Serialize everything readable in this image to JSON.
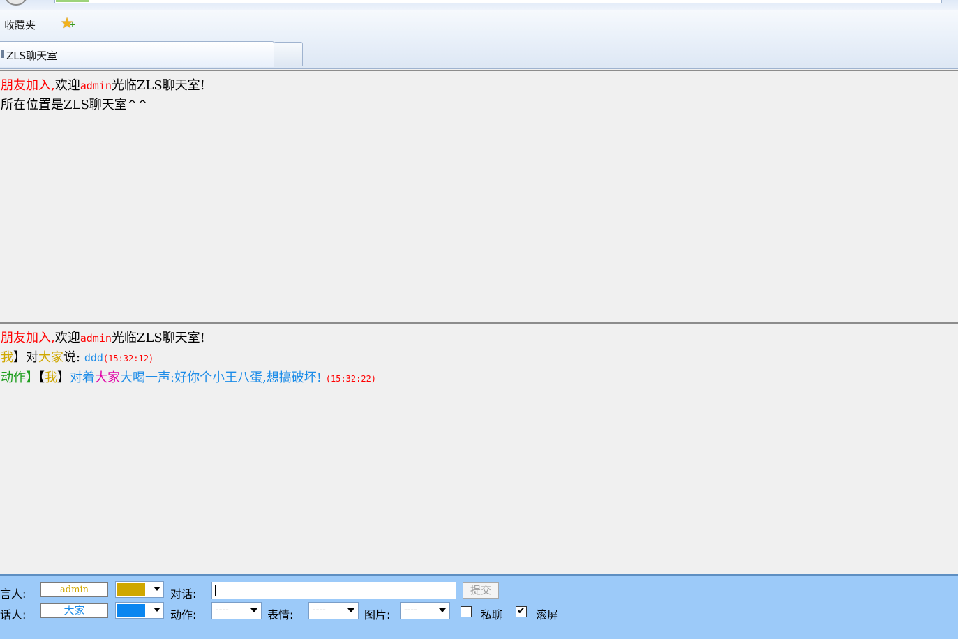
{
  "favorites": {
    "label": "收藏夹",
    "add_icon": "star-add-icon"
  },
  "tab": {
    "title": "ZLS聊天室"
  },
  "top_frame": {
    "line1": {
      "a": "朋友加入,",
      "b": "欢迎",
      "c": "admin",
      "d": "光临ZLS聊天室!"
    },
    "line2": "所在位置是ZLS聊天室^^"
  },
  "bottom_frame": {
    "line1": {
      "a": "朋友加入,",
      "b": "欢迎",
      "c": "admin",
      "d": "光临ZLS聊天室!"
    },
    "line2": {
      "a": "我",
      "b": "】对",
      "c": "大家",
      "d": "说:",
      "e": "ddd",
      "time": "(15:32:12)"
    },
    "line3": {
      "a": "动作】",
      "b": "【",
      "c": "我",
      "d": "】",
      "e": "对着",
      "f": "大家",
      "g": "大喝一声:好你个小王八蛋,想搞破坏!",
      "time": "(15:32:22)"
    }
  },
  "panel": {
    "speaker_label": "言人:",
    "speaker_value": "admin",
    "speaker_color": "#cfa700",
    "dialog_label": "对话:",
    "message_value": "",
    "submit_label": "提交",
    "target_label": "话人:",
    "target_value": "大家",
    "target_color": "#0a86f0",
    "action_label": "动作:",
    "action_value": "----",
    "emotion_label": "表情:",
    "emotion_value": "----",
    "image_label": "图片:",
    "image_value": "----",
    "private_label": "私聊",
    "private_checked": false,
    "scroll_label": "滚屏",
    "scroll_checked": true,
    "check_mark": "✔"
  }
}
